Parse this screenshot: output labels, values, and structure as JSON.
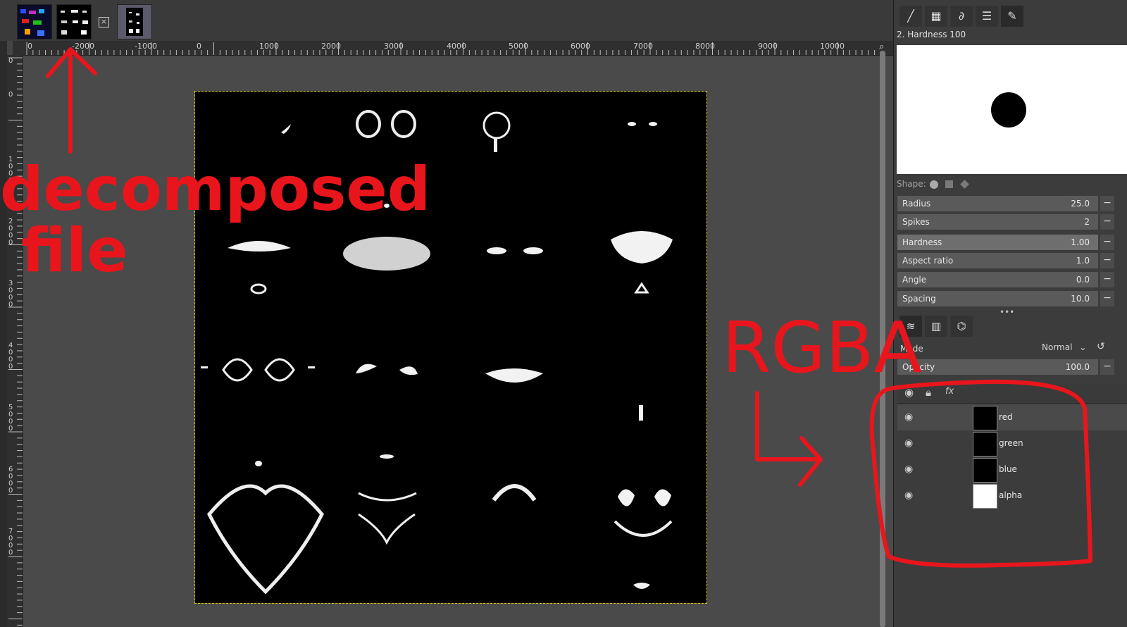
{
  "ruler": {
    "h_labels": [
      "0",
      "-2000",
      "-1000",
      "0",
      "1000",
      "2000",
      "3000",
      "4000",
      "5000",
      "6000",
      "7000",
      "8000",
      "9000",
      "10000"
    ],
    "v_labels": [
      "0",
      "1\n0\n0\n0",
      "2\n0\n0\n0",
      "3\n0\n0\n0",
      "4\n0\n0\n0",
      "5\n0\n0\n0",
      "6\n0\n0\n0",
      "7\n0\n0\n0"
    ]
  },
  "brush": {
    "name": "2. Hardness 100",
    "shape_label": "Shape:",
    "params": [
      {
        "label": "Radius",
        "value": "25.0"
      },
      {
        "label": "Spikes",
        "value": "2"
      },
      {
        "label": "Hardness",
        "value": "1.00"
      },
      {
        "label": "Aspect ratio",
        "value": "1.0"
      },
      {
        "label": "Angle",
        "value": "0.0"
      },
      {
        "label": "Spacing",
        "value": "10.0"
      }
    ]
  },
  "layers_panel": {
    "mode_label": "Mode",
    "mode_value": "Normal",
    "opacity_label": "Opacity",
    "opacity_value": "100.0",
    "fx_label": "fx",
    "layers": [
      {
        "name": "red"
      },
      {
        "name": "green"
      },
      {
        "name": "blue"
      },
      {
        "name": "alpha"
      }
    ]
  },
  "annotations": {
    "left_text_1": "decomposed",
    "left_text_2": "file",
    "right_text": "RGBA",
    "color": "#e8161c"
  }
}
